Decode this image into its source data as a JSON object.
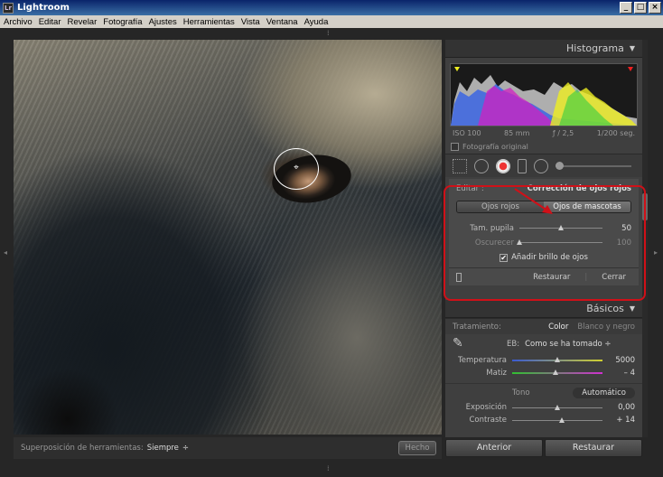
{
  "window": {
    "title": "Lightroom",
    "app_icon": "Lr"
  },
  "menu": [
    "Archivo",
    "Editar",
    "Revelar",
    "Fotografía",
    "Ajustes",
    "Herramientas",
    "Vista",
    "Ventana",
    "Ayuda"
  ],
  "toolbar": {
    "overlay_label": "Superposición de herramientas:",
    "overlay_value": "Siempre",
    "done": "Hecho"
  },
  "histogram": {
    "title": "Histograma",
    "iso": "ISO 100",
    "focal": "85 mm",
    "aperture": "ƒ / 2,5",
    "shutter": "1/200 seg.",
    "original_photo": "Fotografía original"
  },
  "redeye": {
    "edit_label": "Editar :",
    "mode": "Corrección de ojos rojos",
    "tabs": [
      "Ojos rojos",
      "Ojos de mascotas"
    ],
    "selected_tab": 1,
    "sliders": [
      {
        "label": "Tam. pupila",
        "value": "50",
        "fraction": 0.5
      },
      {
        "label": "Oscurecer",
        "value": "100",
        "fraction": 0.0
      }
    ],
    "eye_brightness": "Añadir brillo de ojos",
    "eye_brightness_checked": true,
    "reset": "Restaurar",
    "close": "Cerrar"
  },
  "basics": {
    "title": "Básicos",
    "treatment_label": "Tratamiento:",
    "treatment_color": "Color",
    "treatment_bw": "Blanco y negro",
    "wb_label": "EB:",
    "wb_value": "Como se ha tomado ÷",
    "sliders": [
      {
        "label": "Temperatura",
        "value": "5000",
        "fraction": 0.5,
        "gradient": "linear-gradient(90deg,#3a5ad0,#d0d030)"
      },
      {
        "label": "Matiz",
        "value": "– 4",
        "fraction": 0.48,
        "gradient": "linear-gradient(90deg,#30c030,#d030d0)"
      }
    ],
    "tone_label": "Tono",
    "auto": "Automático",
    "tone_sliders": [
      {
        "label": "Exposición",
        "value": "0,00",
        "fraction": 0.5
      },
      {
        "label": "Contraste",
        "value": "+ 14",
        "fraction": 0.55
      }
    ]
  },
  "nav": {
    "previous": "Anterior",
    "reset": "Restaurar"
  },
  "icons": [
    "app-icon",
    "minimize-icon",
    "maximize-icon",
    "close-icon",
    "crop-icon",
    "spot-removal-icon",
    "redeye-icon",
    "graduated-filter-icon",
    "adjustment-brush-icon",
    "eyedropper-icon"
  ]
}
